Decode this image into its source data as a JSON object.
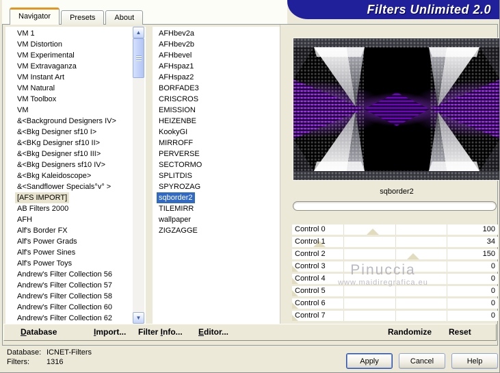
{
  "title": "Filters Unlimited 2.0",
  "tabs": [
    {
      "label": "Navigator",
      "active": true
    },
    {
      "label": "Presets",
      "active": false
    },
    {
      "label": "About",
      "active": false
    }
  ],
  "category_list": {
    "items": [
      "VM 1",
      "VM Distortion",
      "VM Experimental",
      "VM Extravaganza",
      "VM Instant Art",
      "VM Natural",
      "VM Toolbox",
      "VM",
      "&<Background Designers IV>",
      "&<Bkg Designer sf10 I>",
      "&<BKg Designer sf10 II>",
      "&<Bkg Designer sf10 III>",
      "&<Bkg Designers sf10 IV>",
      "&<Bkg Kaleidoscope>",
      "&<Sandflower Specials°v° >",
      "[AFS IMPORT]",
      "AB Filters 2000",
      "AFH",
      "Alf's Border FX",
      "Alf's Power Grads",
      "Alf's Power Sines",
      "Alf's Power Toys",
      "Andrew's Filter Collection 56",
      "Andrew's Filter Collection 57",
      "Andrew's Filter Collection 58",
      "Andrew's Filter Collection 60",
      "Andrew's Filter Collection 62"
    ],
    "highlighted_item": "[AFS IMPORT]"
  },
  "filter_list": {
    "items": [
      "AFHbev2a",
      "AFHbev2b",
      "AFHbevel",
      "AFHspaz1",
      "AFHspaz2",
      "BORFADE3",
      "CRISCROS",
      "EMISSION",
      "HEIZENBE",
      "KookyGI",
      "MIRROFF",
      "PERVERSE",
      "SECTORMO",
      "SPLITDIS",
      "SPYROZAG",
      "sqborder2",
      "TILEMIRR",
      "wallpaper",
      "ZIGZAGGE"
    ],
    "selected_item": "sqborder2"
  },
  "preview": {
    "name": "sqborder2"
  },
  "controls": {
    "range_max": 255,
    "rows": [
      {
        "label": "Control 0",
        "value": 100
      },
      {
        "label": "Control 1",
        "value": 34
      },
      {
        "label": "Control 2",
        "value": 150
      },
      {
        "label": "Control 3",
        "value": 0
      },
      {
        "label": "Control 4",
        "value": 0
      },
      {
        "label": "Control 5",
        "value": 0
      },
      {
        "label": "Control 6",
        "value": 0
      },
      {
        "label": "Control 7",
        "value": 0
      }
    ]
  },
  "watermark": {
    "line1": "Pinuccia",
    "line2": "www.maidiregrafica.eu"
  },
  "menu": {
    "left": [
      {
        "pre": "",
        "u": "D",
        "rest": "atabase"
      },
      {
        "pre": "",
        "u": "I",
        "rest": "mport..."
      },
      {
        "pre": "Filter ",
        "u": "I",
        "rest": "nfo..."
      },
      {
        "pre": "",
        "u": "E",
        "rest": "ditor..."
      }
    ],
    "right": [
      "Randomize",
      "Reset"
    ]
  },
  "footer": {
    "database_label": "Database:",
    "database_value": "ICNET-Filters",
    "filters_label": "Filters:",
    "filters_value": "1316",
    "buttons": [
      "Apply",
      "Cancel",
      "Help"
    ]
  },
  "colors": {
    "banner-blue": "#20209a",
    "tab-accent-orange": "#e5941e",
    "selection-blue": "#316ac5",
    "highlight-beige": "#e7e3cc",
    "window-beige": "#ece9d8",
    "purple-accent": "#7c00d8"
  }
}
